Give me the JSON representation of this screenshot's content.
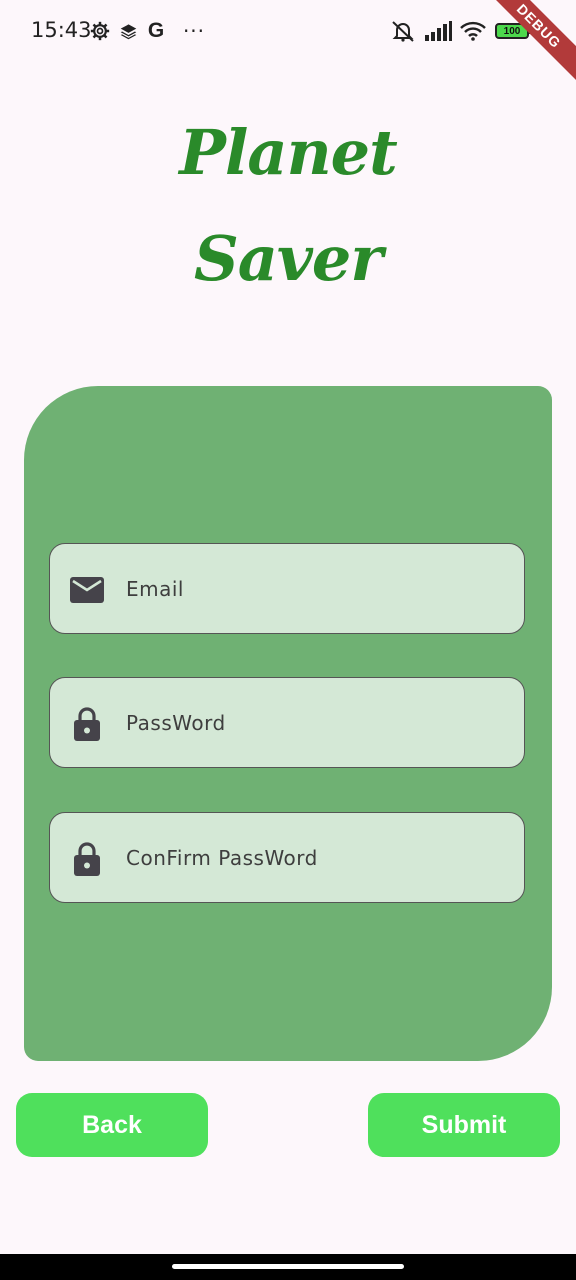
{
  "status_bar": {
    "time": "15:43",
    "left_icons": [
      "settings-gear-icon",
      "layers-icon",
      "google-g-icon",
      "more-dots-icon"
    ],
    "google_letter": "G",
    "more_dots": "···",
    "right_icons": [
      "alarm-off-icon",
      "signal-icon",
      "wifi-icon",
      "battery-icon"
    ],
    "battery_level": "100"
  },
  "debug_banner": "DEBUG",
  "app_title": {
    "line1": "Planet",
    "line2": "Saver",
    "color": "#2a8a2a"
  },
  "form": {
    "card_color": "#6fb173",
    "field_color": "#d4e8d6",
    "fields": [
      {
        "label": "Email",
        "icon": "email-icon"
      },
      {
        "label": "PassWord",
        "icon": "lock-icon"
      },
      {
        "label": "ConFirm PassWord",
        "icon": "lock-icon"
      }
    ]
  },
  "buttons": {
    "back_label": "Back",
    "submit_label": "Submit",
    "color": "#4fe05c"
  }
}
